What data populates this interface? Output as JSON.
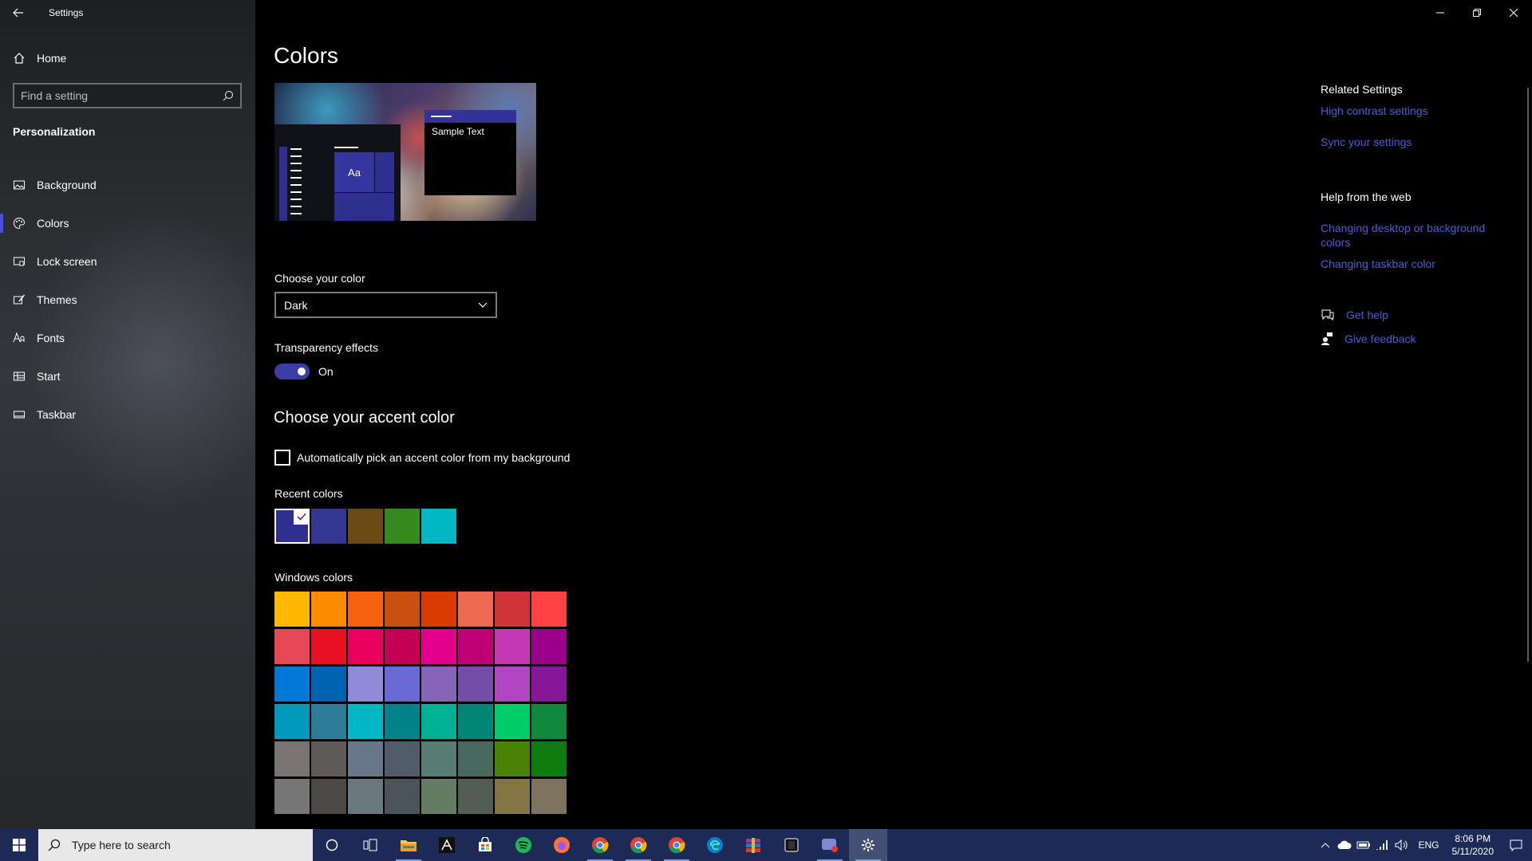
{
  "window": {
    "title": "Settings"
  },
  "sidebar": {
    "home_label": "Home",
    "search_placeholder": "Find a setting",
    "section_title": "Personalization",
    "items": [
      {
        "label": "Background",
        "icon": "picture-icon"
      },
      {
        "label": "Colors",
        "icon": "palette-icon",
        "active": true
      },
      {
        "label": "Lock screen",
        "icon": "lock-screen-icon"
      },
      {
        "label": "Themes",
        "icon": "brush-icon"
      },
      {
        "label": "Fonts",
        "icon": "font-icon"
      },
      {
        "label": "Start",
        "icon": "start-icon"
      },
      {
        "label": "Taskbar",
        "icon": "taskbar-icon"
      }
    ]
  },
  "main": {
    "page_title": "Colors",
    "preview": {
      "sample_text": "Sample Text",
      "tile_text": "Aa"
    },
    "choose_color": {
      "label": "Choose your color",
      "value": "Dark"
    },
    "transparency": {
      "label": "Transparency effects",
      "state": "On"
    },
    "accent": {
      "heading": "Choose your accent color",
      "auto_pick_label": "Automatically pick an accent color from my background",
      "recent_label": "Recent colors",
      "recent_colors": [
        "#2e2f8f",
        "#35368f",
        "#6b4a14",
        "#358a1d",
        "#00b7c3"
      ],
      "windows_label": "Windows colors",
      "windows_colors": [
        "#ffb900",
        "#ff8c00",
        "#f7630c",
        "#ca5010",
        "#da3b01",
        "#ef6950",
        "#d13438",
        "#ff4343",
        "#e74856",
        "#e81123",
        "#ea005e",
        "#c30052",
        "#e3008c",
        "#bf0077",
        "#c239b3",
        "#9a0089",
        "#0078d7",
        "#0063b1",
        "#8e8cd8",
        "#6b69d6",
        "#8764b8",
        "#744da9",
        "#b146c2",
        "#881798",
        "#0099bc",
        "#2d7d9a",
        "#00b7c3",
        "#038387",
        "#00b294",
        "#018574",
        "#00cc6a",
        "#10893e",
        "#7a7574",
        "#5d5a58",
        "#68768a",
        "#515c6b",
        "#567c73",
        "#486860",
        "#498205",
        "#107c10",
        "#767676",
        "#4c4a48",
        "#69797e",
        "#4a5459",
        "#647c64",
        "#525e54",
        "#847545",
        "#7e735f"
      ]
    }
  },
  "related": {
    "heading": "Related Settings",
    "links": [
      "High contrast settings",
      "Sync your settings"
    ],
    "web_heading": "Help from the web",
    "web_links": [
      "Changing desktop or background colors",
      "Changing taskbar color"
    ],
    "get_help": "Get help",
    "give_feedback": "Give feedback"
  },
  "taskbar": {
    "search_placeholder": "Type here to search",
    "language": "ENG",
    "time": "8:06 PM",
    "date": "5/11/2020"
  },
  "colors": {
    "accent": "#4a4de0",
    "link": "#4d5ad8",
    "taskbar": "#1c2a55"
  }
}
